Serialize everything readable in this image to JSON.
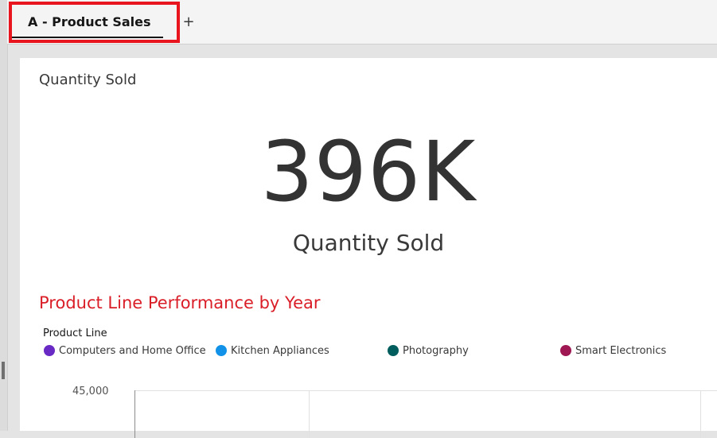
{
  "tabs": [
    {
      "label": "A - Product Sales",
      "active": true
    }
  ],
  "add_tab_icon": "+",
  "kpi": {
    "widget_title": "Quantity Sold",
    "value": "396K",
    "label": "Quantity Sold"
  },
  "chart": {
    "title": "Product Line Performance by Year",
    "legend_title": "Product Line",
    "legend": [
      {
        "label": "Computers and Home Office",
        "color": "#6929c4"
      },
      {
        "label": "Kitchen Appliances",
        "color": "#1192e8"
      },
      {
        "label": "Photography",
        "color": "#005d5d"
      },
      {
        "label": "Smart Electronics",
        "color": "#9f1853"
      }
    ],
    "y_tick_top": "45,000"
  },
  "colors": {
    "highlight": "#e8141e",
    "chart_title": "#da1e28"
  }
}
